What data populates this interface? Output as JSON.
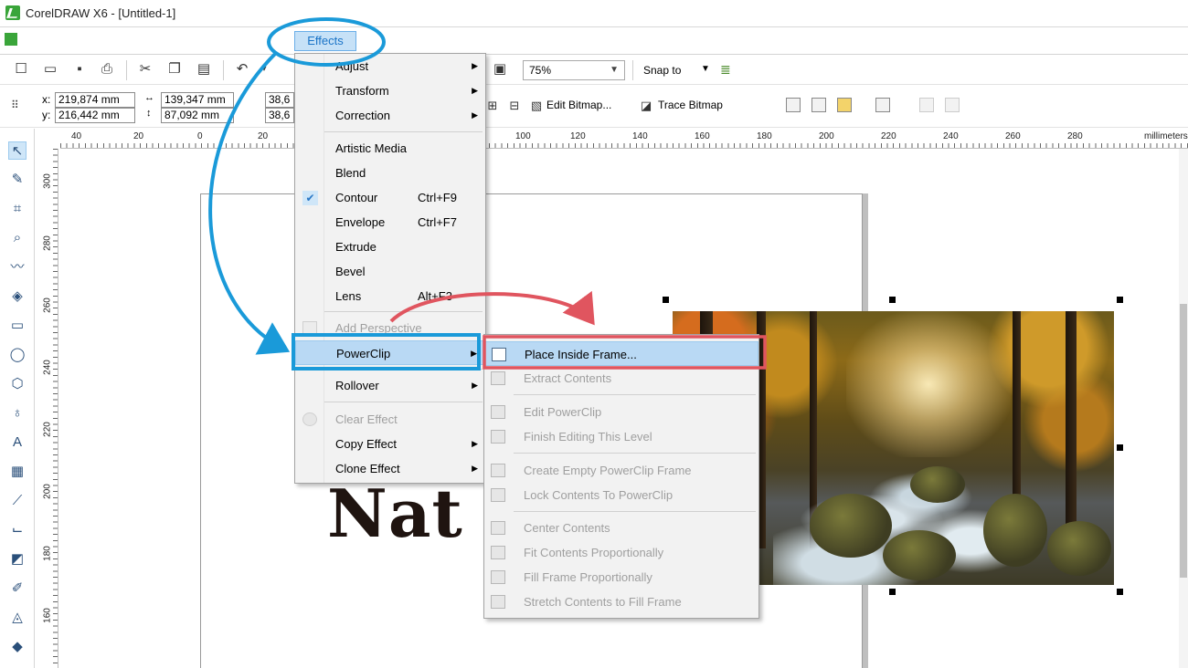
{
  "window": {
    "title": "CorelDRAW X6 - [Untitled-1]"
  },
  "menubar": {
    "effects_label": "Effects"
  },
  "toolbar": {
    "zoom_value": "75%",
    "snap_label": "Snap to"
  },
  "propbar": {
    "x_label": "x:",
    "y_label": "y:",
    "x_value": "219,874 mm",
    "y_value": "216,442 mm",
    "w_value": "139,347 mm",
    "h_value": "87,092 mm",
    "sx_value": "38,6",
    "sy_value": "38,6",
    "edit_bitmap": "Edit Bitmap...",
    "trace_bitmap": "Trace Bitmap"
  },
  "ruler": {
    "h_labels": [
      "40",
      "20",
      "0",
      "20",
      "100",
      "120",
      "140",
      "160",
      "180",
      "200",
      "220",
      "240",
      "260",
      "280",
      "millimeters"
    ],
    "v_labels": [
      "300",
      "280",
      "260",
      "240",
      "220",
      "200",
      "180",
      "160"
    ]
  },
  "canvas": {
    "heading_text": "Nat"
  },
  "effects_menu": {
    "items": [
      {
        "label": "Adjust",
        "shortcut": "",
        "submenu": true,
        "disabled": false
      },
      {
        "label": "Transform",
        "shortcut": "",
        "submenu": true,
        "disabled": false
      },
      {
        "label": "Correction",
        "shortcut": "",
        "submenu": true,
        "disabled": false
      },
      {
        "label": "Artistic Media",
        "shortcut": "",
        "submenu": false,
        "disabled": false
      },
      {
        "label": "Blend",
        "shortcut": "",
        "submenu": false,
        "disabled": false
      },
      {
        "label": "Contour",
        "shortcut": "Ctrl+F9",
        "submenu": false,
        "disabled": false,
        "checked": true
      },
      {
        "label": "Envelope",
        "shortcut": "Ctrl+F7",
        "submenu": false,
        "disabled": false
      },
      {
        "label": "Extrude",
        "shortcut": "",
        "submenu": false,
        "disabled": false
      },
      {
        "label": "Bevel",
        "shortcut": "",
        "submenu": false,
        "disabled": false
      },
      {
        "label": "Lens",
        "shortcut": "Alt+F3",
        "submenu": false,
        "disabled": false
      },
      {
        "label": "Add Perspective",
        "shortcut": "",
        "submenu": false,
        "disabled": true
      },
      {
        "label": "PowerClip",
        "shortcut": "",
        "submenu": true,
        "disabled": false,
        "highlighted": true
      },
      {
        "label": "Rollover",
        "shortcut": "",
        "submenu": true,
        "disabled": false
      },
      {
        "label": "Clear Effect",
        "shortcut": "",
        "submenu": false,
        "disabled": true
      },
      {
        "label": "Copy Effect",
        "shortcut": "",
        "submenu": true,
        "disabled": false
      },
      {
        "label": "Clone Effect",
        "shortcut": "",
        "submenu": true,
        "disabled": false
      }
    ]
  },
  "powerclip_menu": {
    "items": [
      {
        "label": "Place Inside Frame...",
        "disabled": false,
        "highlighted": true,
        "icon": "place-inside-frame-icon"
      },
      {
        "label": "Extract Contents",
        "disabled": true,
        "icon": "extract-contents-icon"
      },
      {
        "label": "Edit PowerClip",
        "disabled": true,
        "icon": "edit-powerclip-icon"
      },
      {
        "label": "Finish Editing This Level",
        "disabled": true,
        "icon": "finish-editing-icon"
      },
      {
        "label": "Create Empty PowerClip Frame",
        "disabled": true,
        "icon": "empty-frame-icon"
      },
      {
        "label": "Lock Contents To PowerClip",
        "disabled": true,
        "icon": "lock-contents-icon"
      },
      {
        "label": "Center Contents",
        "disabled": true,
        "icon": "center-contents-icon"
      },
      {
        "label": "Fit Contents Proportionally",
        "disabled": true,
        "icon": "fit-contents-icon"
      },
      {
        "label": "Fill Frame Proportionally",
        "disabled": true,
        "icon": "fill-frame-icon"
      },
      {
        "label": "Stretch Contents to Fill Frame",
        "disabled": true,
        "icon": "stretch-contents-icon"
      }
    ]
  },
  "colors": {
    "accent_blue": "#1a9ad9",
    "accent_red": "#e0555f",
    "menu_highlight": "#b9d9f4"
  }
}
